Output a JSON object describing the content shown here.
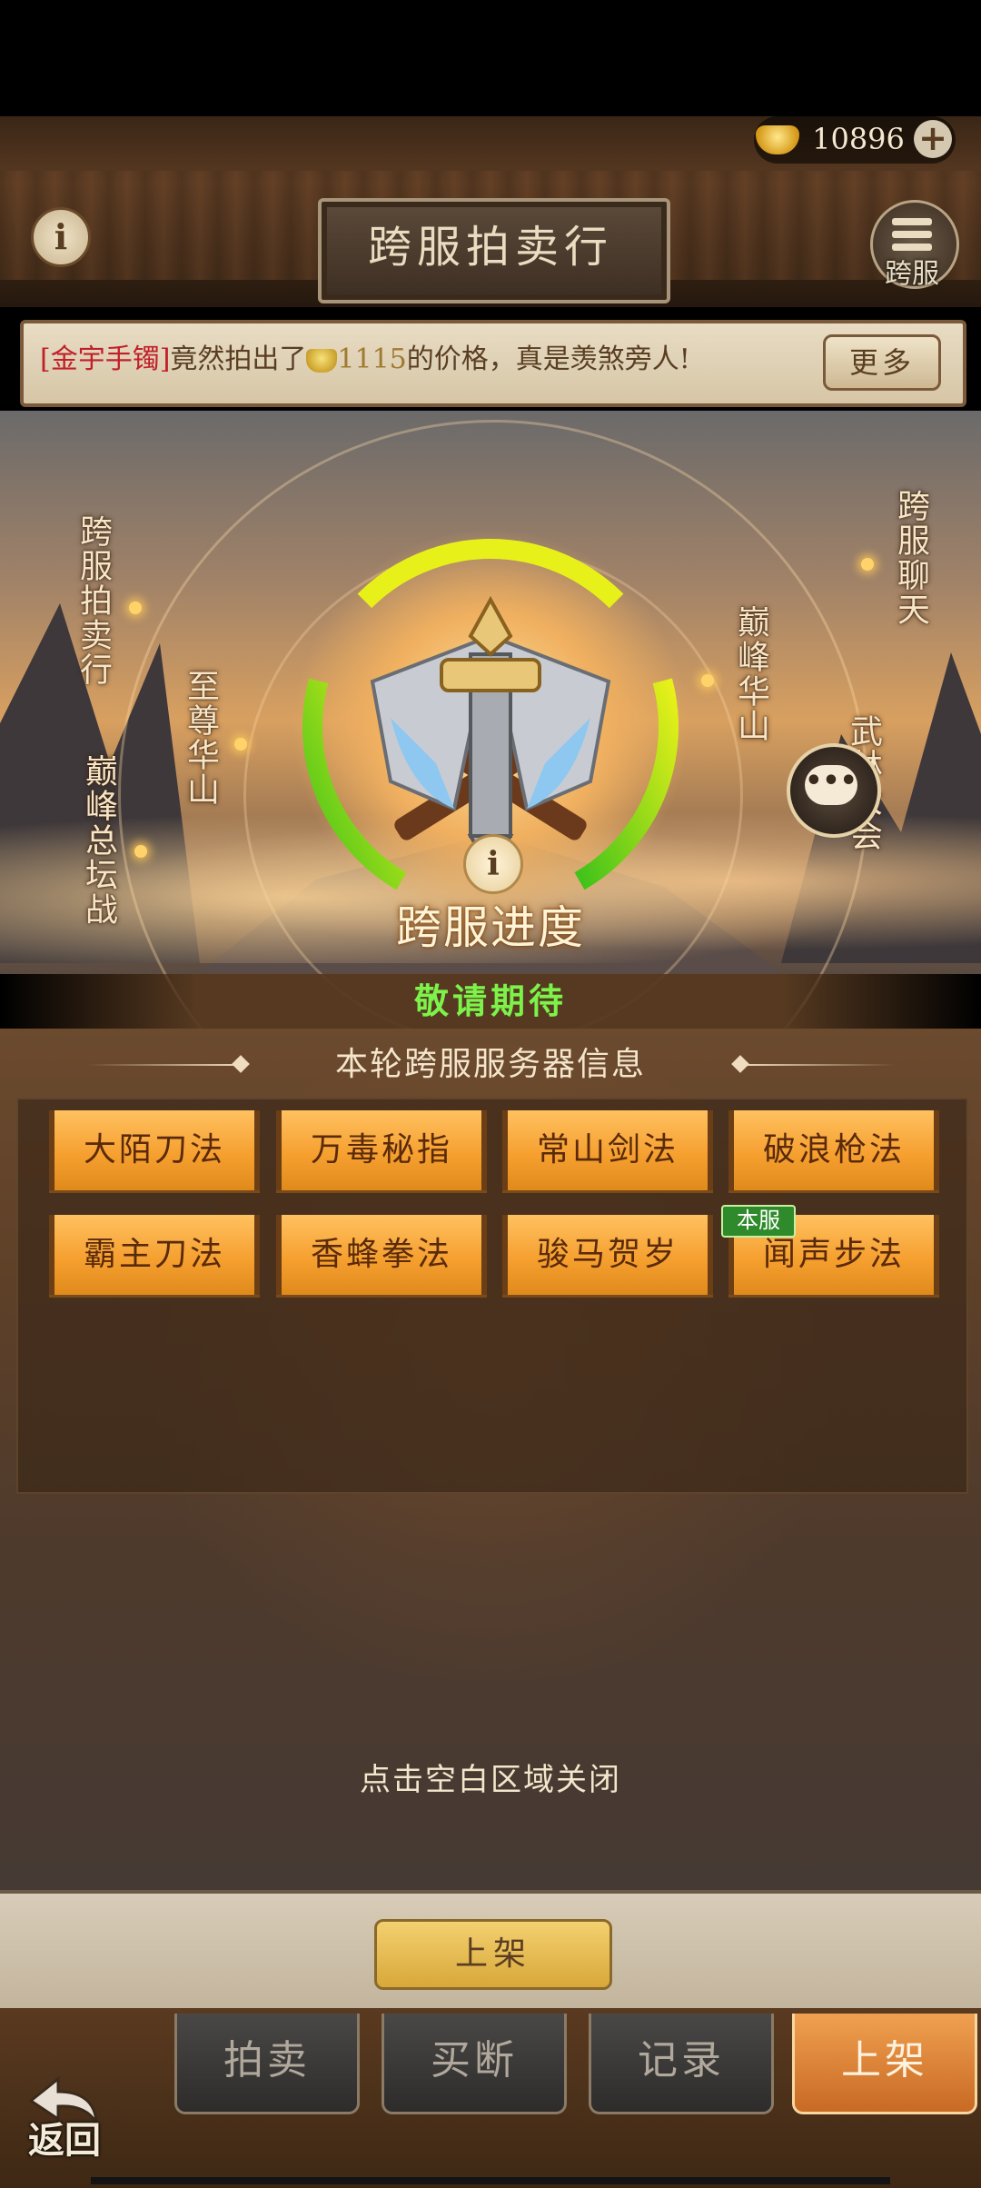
{
  "header": {
    "title": "跨服拍卖行",
    "currency_value": "10896",
    "currency_plus": "+",
    "info_icon_label": "i",
    "cross_server_label": "跨服"
  },
  "ticker": {
    "item": "[金宇手镯]",
    "mid": "竟然拍出了",
    "amount": "1115",
    "tail": "的价格，真是羡煞旁人!",
    "more_label": "更多"
  },
  "progress": {
    "title": "跨服进度",
    "info_label": "i",
    "ring_green_fraction": 0.5,
    "nodes": [
      {
        "label": "跨服拍卖行"
      },
      {
        "label": "巅峰总坛战"
      },
      {
        "label": "至尊华山"
      },
      {
        "label": "巅峰华山"
      },
      {
        "label": "跨服聊天"
      },
      {
        "label": "武林大会"
      }
    ],
    "chat_icon": "chat-bubble-icon",
    "status": "敬请期待"
  },
  "servers": {
    "section_title": "本轮跨服服务器信息",
    "items": [
      {
        "name": "大陌刀法"
      },
      {
        "name": "万毒秘指"
      },
      {
        "name": "常山剑法"
      },
      {
        "name": "破浪枪法"
      },
      {
        "name": "霸主刀法"
      },
      {
        "name": "香蜂拳法"
      },
      {
        "name": "骏马贺岁"
      },
      {
        "name": "闻声步法",
        "tag": "本服"
      }
    ]
  },
  "close_hint": "点击空白区域关闭",
  "list_button": "上架",
  "tabs": [
    {
      "label": "拍卖",
      "active": false
    },
    {
      "label": "买断",
      "active": false
    },
    {
      "label": "记录",
      "active": false
    },
    {
      "label": "上架",
      "active": true
    }
  ],
  "back_label": "返回",
  "colors": {
    "status_green": "#7cf24a",
    "button_orange": "#f6a030",
    "tag_green": "#2e8a2a",
    "ticker_highlight": "#c0202a"
  }
}
